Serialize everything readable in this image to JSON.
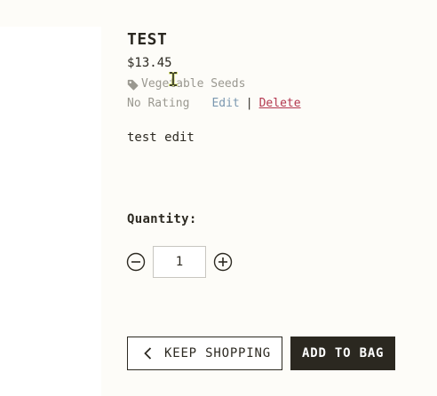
{
  "product": {
    "title": "TEST",
    "price": "$13.45",
    "category": "Vegetable Seeds",
    "rating": "No Rating",
    "edit_label": "Edit",
    "separator": "|",
    "delete_label": "Delete",
    "description": "test edit"
  },
  "quantity": {
    "label": "Quantity:",
    "value": "1",
    "decrement_icon": "minus-circle-icon",
    "increment_icon": "plus-circle-icon"
  },
  "actions": {
    "keep_shopping_label": "KEEP SHOPPING",
    "add_to_bag_label": "ADD TO BAG"
  },
  "icons": {
    "category": "tag-icon",
    "keep_shopping": "chevron-left-icon",
    "cursor": "text-cursor-icon"
  },
  "colors": {
    "background": "#fdfcf8",
    "text": "#2d2a22",
    "muted": "#9a9890",
    "edit_link": "#7b98b0",
    "delete_link": "#b3364e",
    "primary_button": "#2b2820"
  }
}
